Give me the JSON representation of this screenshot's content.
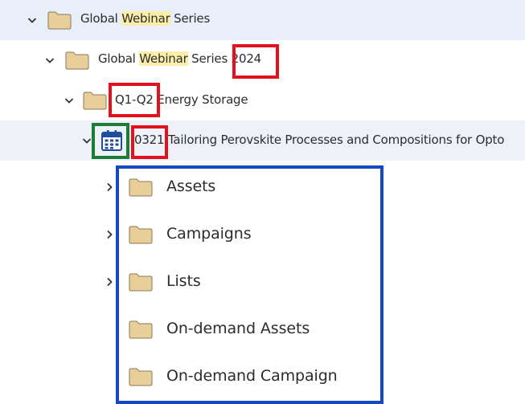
{
  "tree": {
    "root": {
      "label_pre": "Global ",
      "label_hl": "Webinar",
      "label_post": " Series"
    },
    "year": {
      "label_pre": "Global ",
      "label_hl": "Webinar",
      "label_post": " Series",
      "label_year": " 2024"
    },
    "quarter": {
      "label_code": "Q1-Q2",
      "label_rest": " Energy Storage"
    },
    "event": {
      "label_code": "0321",
      "label_rest": " Tailoring Perovskite Processes and Compositions for Opto"
    },
    "children": [
      {
        "label": "Assets"
      },
      {
        "label": "Campaigns"
      },
      {
        "label": "Lists"
      },
      {
        "label": "On-demand Assets"
      },
      {
        "label": "On-demand Campaign"
      }
    ]
  },
  "icons": {
    "folder": "folder-icon",
    "calendar": "calendar-icon",
    "expanded": "chevron-down-icon",
    "collapsed": "chevron-right-icon"
  },
  "colors": {
    "folder_fill": "#e8cf9a",
    "folder_stroke": "#8a7a5a",
    "highlight": "#fbeea8",
    "calendar": "#1f4f9c",
    "annotation_red": "#e3111b",
    "annotation_green": "#1b7d3a",
    "annotation_blue": "#1748c4"
  }
}
